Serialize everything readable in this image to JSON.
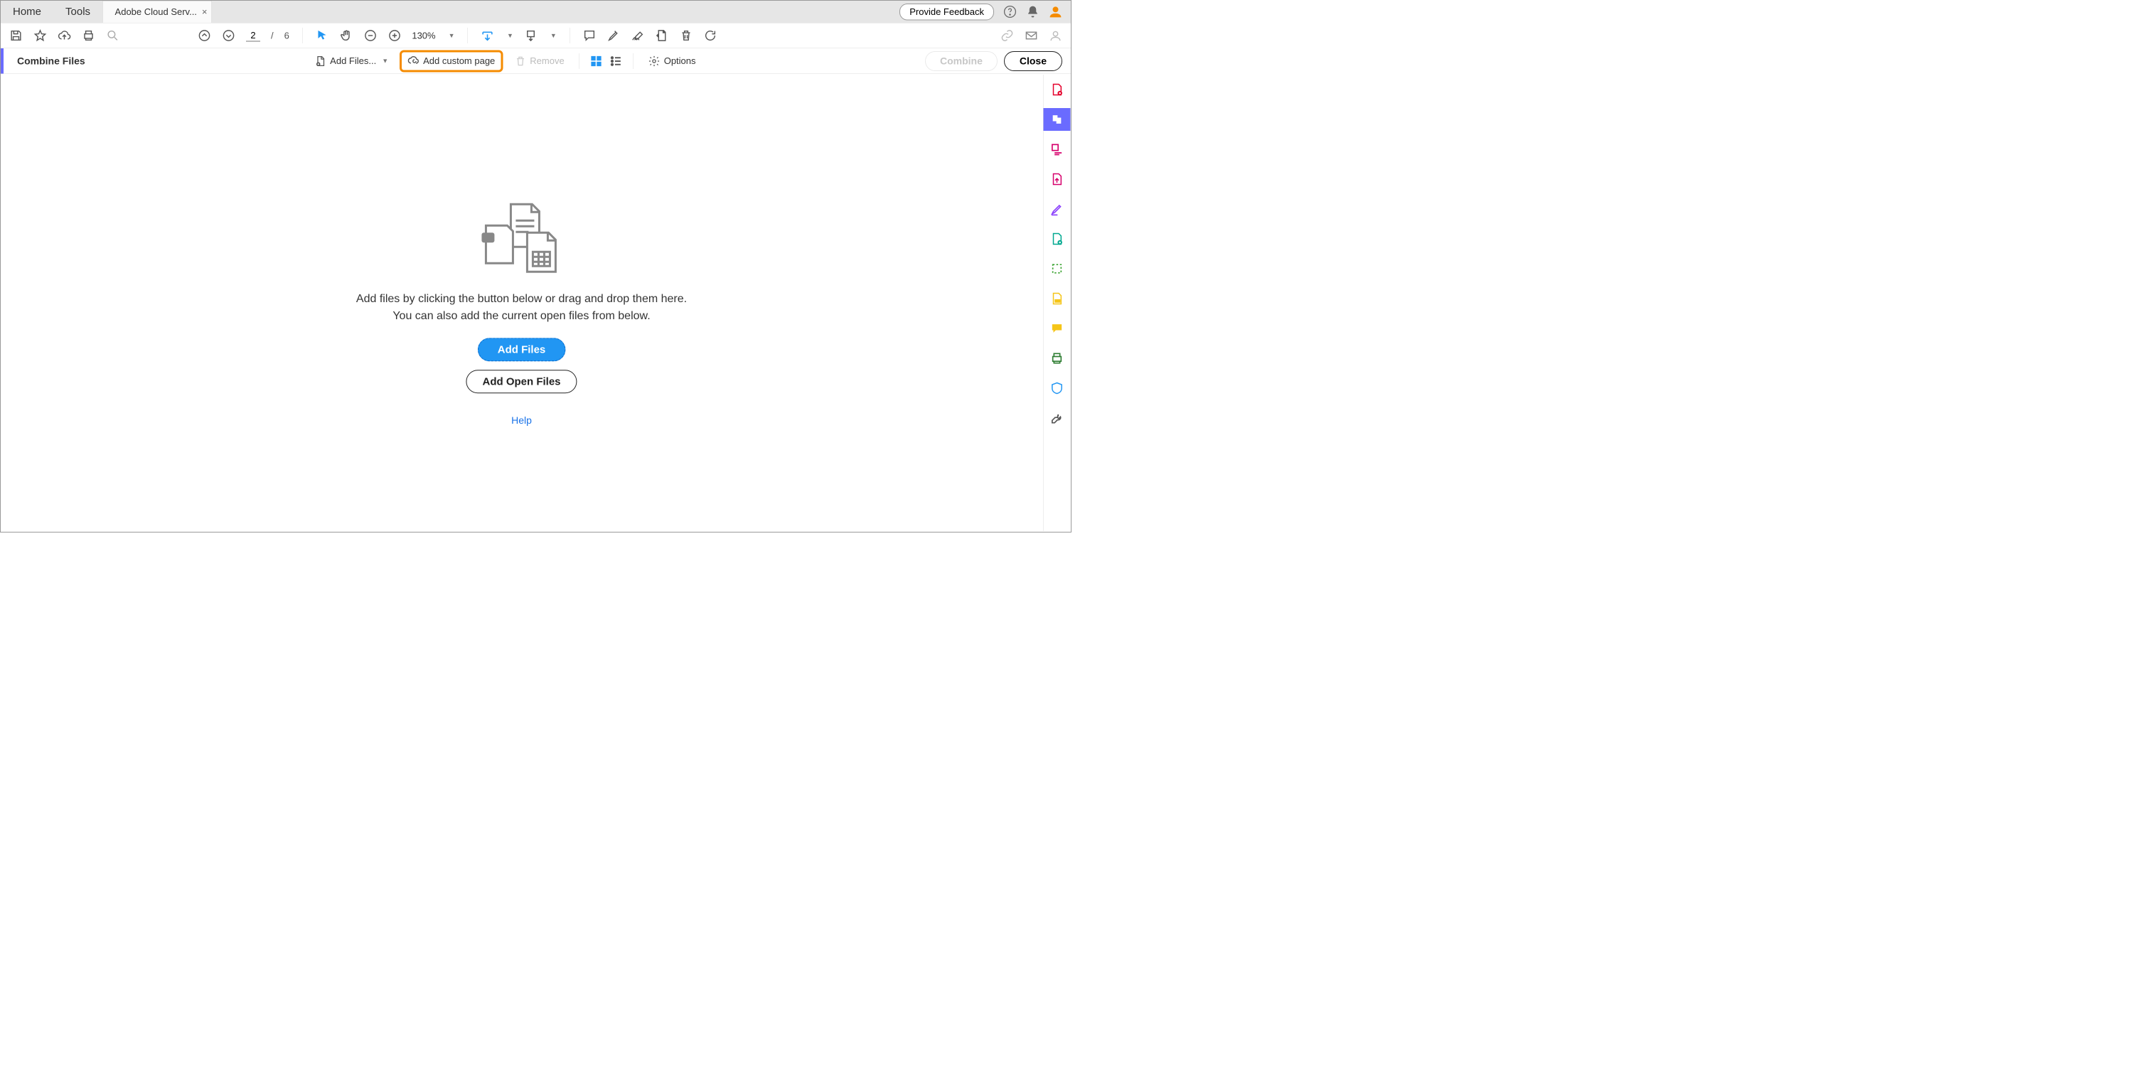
{
  "top": {
    "tabs": [
      "Home",
      "Tools"
    ],
    "active_tab": "Adobe Cloud Serv...",
    "feedback": "Provide Feedback"
  },
  "toolbar": {
    "page_current": "2",
    "page_sep": "/",
    "page_total": "6",
    "zoom": "130%"
  },
  "combine": {
    "title": "Combine Files",
    "add_files": "Add Files...",
    "add_custom": "Add custom page",
    "remove": "Remove",
    "options": "Options",
    "combine_btn": "Combine",
    "close_btn": "Close"
  },
  "empty": {
    "line1": "Add files by clicking the button below or drag and drop them here.",
    "line2": "You can also add the current open files from below.",
    "add_files_btn": "Add Files",
    "add_open_btn": "Add Open Files",
    "help": "Help"
  },
  "colors": {
    "accent": "#6a6bff",
    "primary": "#2196f3",
    "highlight": "#f58b00"
  }
}
